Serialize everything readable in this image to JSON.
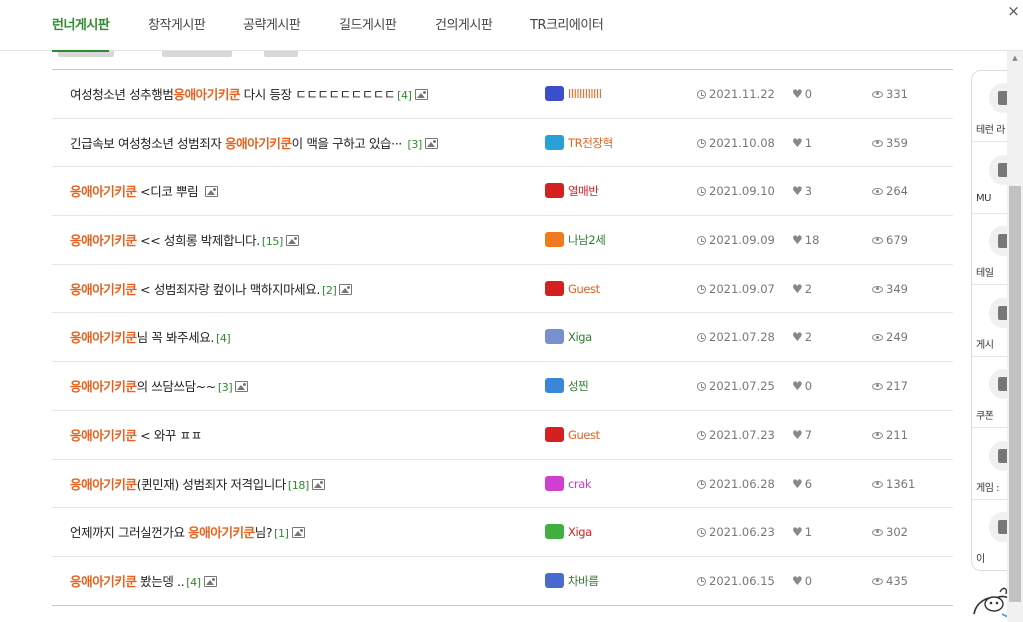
{
  "tabs": [
    {
      "label": "런너게시판",
      "active": true
    },
    {
      "label": "창작게시판",
      "active": false
    },
    {
      "label": "공략게시판",
      "active": false
    },
    {
      "label": "길드게시판",
      "active": false
    },
    {
      "label": "건의게시판",
      "active": false
    },
    {
      "label": "TR크리에이터",
      "active": false
    }
  ],
  "close_glyph": "×",
  "posts": [
    {
      "pre": "여성청소년 성추행범",
      "kw": "응애아기키쿤",
      "post": " 다시 등장 ㄷㄷㄷㄷㄷㄷㄷㄷㄷ",
      "count": "[4]",
      "has_image": true,
      "author": "llllllllllll",
      "author_color": "#e8601c",
      "avatar_color": "#3a4fc9",
      "date": "2021.11.22",
      "likes": "0",
      "views": "331"
    },
    {
      "pre": "긴급속보 여성청소년 성범죄자 ",
      "kw": "응애아기키쿤",
      "post": "이 맥을 구하고 있습··· ",
      "count": "[3]",
      "has_image": true,
      "author": "TR전장혁",
      "author_color": "#e8601c",
      "avatar_color": "#2aa0d8",
      "date": "2021.10.08",
      "likes": "1",
      "views": "359"
    },
    {
      "pre": "",
      "kw": "응애아기키쿤",
      "post": " <디코 뿌림 ",
      "count": "",
      "has_image": true,
      "author": "열매반",
      "author_color": "#d42020",
      "avatar_color": "#d42020",
      "date": "2021.09.10",
      "likes": "3",
      "views": "264"
    },
    {
      "pre": "",
      "kw": "응애아기키쿤",
      "post": " << 성희롱 박제합니다.",
      "count": "[15]",
      "has_image": true,
      "author": "나남2세",
      "author_color": "#2e7d2e",
      "avatar_color": "#f07a20",
      "date": "2021.09.09",
      "likes": "18",
      "views": "679"
    },
    {
      "pre": "",
      "kw": "응애아기키쿤",
      "post": " < 성범죄자랑 컾이나 맥하지마세요.",
      "count": "[2]",
      "has_image": true,
      "author": "Guest",
      "author_color": "#e8601c",
      "avatar_color": "#d42020",
      "date": "2021.09.07",
      "likes": "2",
      "views": "349"
    },
    {
      "pre": "",
      "kw": "응애아기키쿤",
      "post": "님 꼭 봐주세요.",
      "count": "[4]",
      "has_image": false,
      "author": "Xiga",
      "author_color": "#2e7d2e",
      "avatar_color": "#7a8fd0",
      "date": "2021.07.28",
      "likes": "2",
      "views": "249"
    },
    {
      "pre": "",
      "kw": "응애아기키쿤",
      "post": "의 쓰담쓰담~~",
      "count": "[3]",
      "has_image": true,
      "author": "성찐",
      "author_color": "#2e7d2e",
      "avatar_color": "#3a86d8",
      "date": "2021.07.25",
      "likes": "0",
      "views": "217"
    },
    {
      "pre": "",
      "kw": "응애아기키쿤",
      "post": " < 와꾸 ㅍㅍ",
      "count": "",
      "has_image": false,
      "author": "Guest",
      "author_color": "#e8601c",
      "avatar_color": "#d42020",
      "date": "2021.07.23",
      "likes": "7",
      "views": "211"
    },
    {
      "pre": "",
      "kw": "응애아기키쿤",
      "post": "(퀸민재) 성범죄자 저격입니다",
      "count": "[18]",
      "has_image": true,
      "author": "crak",
      "author_color": "#c040c0",
      "avatar_color": "#d040d0",
      "date": "2021.06.28",
      "likes": "6",
      "views": "1361"
    },
    {
      "pre": "언제까지 그러실껀가요 ",
      "kw": "응애아기키쿤",
      "post": "님?",
      "count": "[1]",
      "has_image": true,
      "author": "Xiga",
      "author_color": "#d42020",
      "avatar_color": "#40b040",
      "date": "2021.06.23",
      "likes": "1",
      "views": "302"
    },
    {
      "pre": "",
      "kw": "응애아기키쿤",
      "post": " 봤는뎅 ..",
      "count": "[4]",
      "has_image": true,
      "author": "차바름",
      "author_color": "#2e7d2e",
      "avatar_color": "#4a6ad0",
      "date": "2021.06.15",
      "likes": "0",
      "views": "435"
    }
  ],
  "quick_menu": [
    {
      "label": "테런 라"
    },
    {
      "label": "MU"
    },
    {
      "label": "테일"
    },
    {
      "label": "게시"
    },
    {
      "label": "쿠폰"
    },
    {
      "label": "게임 :"
    },
    {
      "label": "이"
    }
  ]
}
